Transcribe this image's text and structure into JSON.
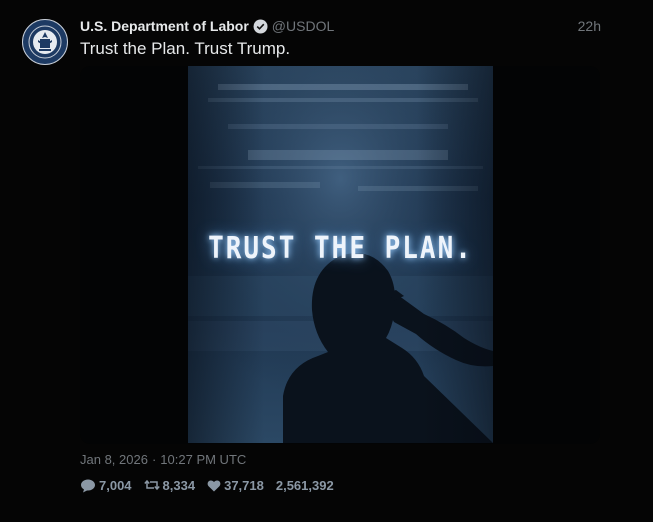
{
  "account": {
    "display_name": "U.S. Department of Labor",
    "handle": "@USDOL",
    "avatar_icon": "department-of-labor-seal",
    "verified_icon": "verified-badge-icon"
  },
  "tweet": {
    "relative_time": "22h",
    "text": "Trust the Plan. Trust Trump.",
    "media": {
      "headline": "TRUST THE PLAN."
    },
    "date": "Jan 8, 2026",
    "separator": "·",
    "time": "10:27 PM UTC"
  },
  "stats": {
    "replies": "7,004",
    "retweets": "8,334",
    "likes": "37,718",
    "views": "2,561,392"
  },
  "colors": {
    "background": "#000000",
    "text": "#e7e9ea",
    "muted": "#71767b",
    "stat": "#8b98a5"
  }
}
